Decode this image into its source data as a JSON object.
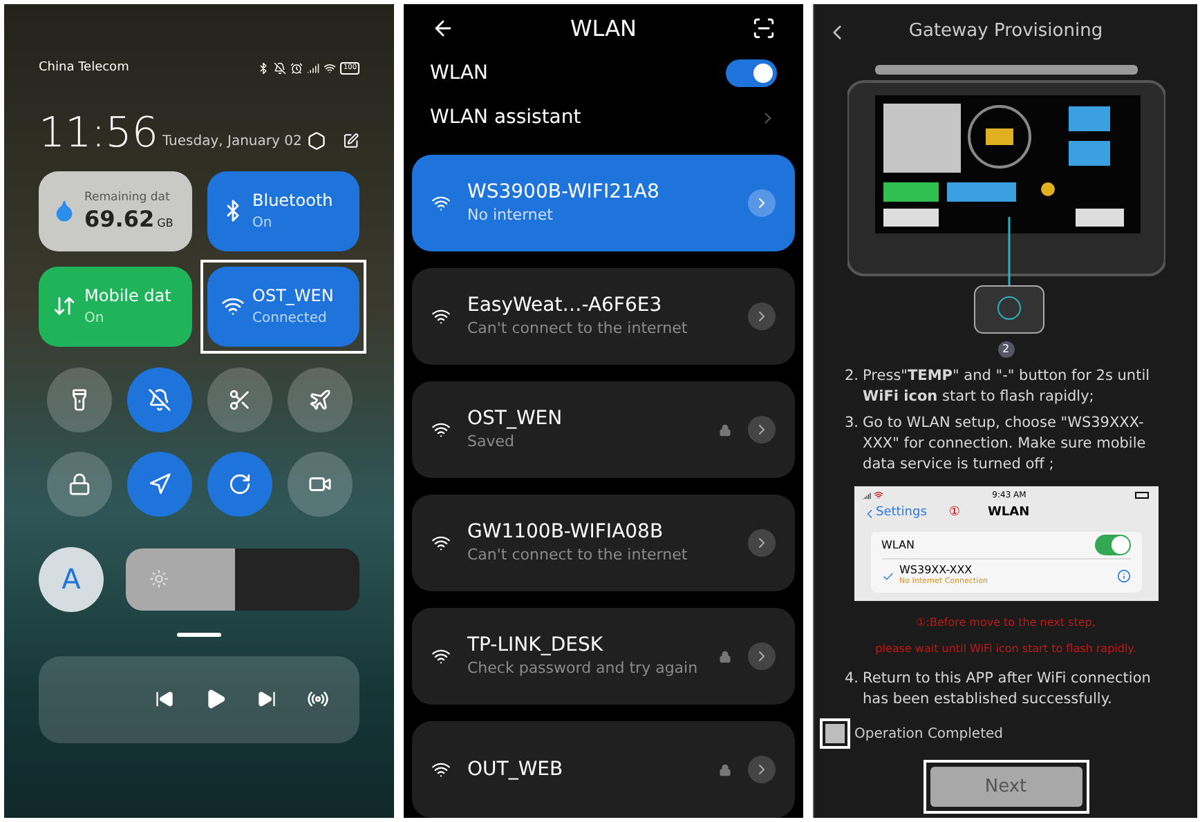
{
  "control_center": {
    "status_bar": {
      "carrier": "China Telecom",
      "battery": "100"
    },
    "time": "11:56",
    "date": "Tuesday, January 02",
    "tiles": [
      {
        "kind": "data",
        "title": "Remaining dat",
        "value": "69.62",
        "unit": "GB",
        "on": false,
        "highlighted": false
      },
      {
        "kind": "bluetooth",
        "title": "Bluetooth",
        "status": "On",
        "on": true,
        "highlighted": false
      },
      {
        "kind": "mobile",
        "title": "Mobile dat",
        "status": "On",
        "on": true,
        "highlighted": false
      },
      {
        "kind": "wifi",
        "title": "OST_WEN",
        "status": "Connected",
        "on": true,
        "highlighted": true
      }
    ],
    "toggles": [
      {
        "kind": "flashlight",
        "on": false
      },
      {
        "kind": "mute",
        "on": true
      },
      {
        "kind": "screenshot",
        "on": false
      },
      {
        "kind": "airplane",
        "on": false
      },
      {
        "kind": "lock",
        "on": false
      },
      {
        "kind": "location",
        "on": true
      },
      {
        "kind": "rotation",
        "on": true
      },
      {
        "kind": "video",
        "on": false
      }
    ],
    "auto_brightness": "A",
    "brightness": {
      "level": 0.47
    }
  },
  "wlan": {
    "title": "WLAN",
    "toggle_label": "WLAN",
    "enabled": true,
    "assistant": "WLAN assistant",
    "networks": [
      {
        "name": "WS3900B-WIFI21A8",
        "status": "No internet",
        "locked": false,
        "selected": true
      },
      {
        "name": "EasyWeat…-A6F6E3",
        "status": "Can't connect to the internet",
        "locked": false,
        "selected": false
      },
      {
        "name": "OST_WEN",
        "status": "Saved",
        "locked": true,
        "selected": false
      },
      {
        "name": "GW1100B-WIFIA08B",
        "status": "Can't connect to the internet",
        "locked": false,
        "selected": false
      },
      {
        "name": "TP-LINK_DESK",
        "status": "Check password and try again",
        "locked": true,
        "selected": false
      },
      {
        "name": "OUT_WEB",
        "locked": true,
        "selected": false
      }
    ]
  },
  "provisioning": {
    "title": "Gateway Provisioning",
    "callout": "2",
    "steps": [
      {
        "number": "2.",
        "text": "Press\"**TEMP**\" and \"-\" button for 2s until **WiFi icon** start to flash rapidly;"
      },
      {
        "number": "3.",
        "text": "Go to WLAN setup, choose \"WS39XXX-XXX\" for connection. Make sure mobile data service is turned off ;"
      }
    ],
    "screenshot": {
      "time": "9:43 AM",
      "back": "Settings",
      "marker": "①",
      "title": "WLAN",
      "toggle_label": "WLAN",
      "on": true,
      "network": "WS39XX-XXX",
      "network_status": "No Internet Connection"
    },
    "warnings": [
      "①:Before move to the next step,",
      "please wait until WiFi icon start to flash rapidly."
    ],
    "final_step": {
      "number": "4.",
      "text": "Return to this APP after WiFi connection has been established successfully."
    },
    "checkbox": {
      "label": "Operation Completed",
      "checked": false,
      "highlighted": true
    },
    "next_button": {
      "label": "Next",
      "disabled": true,
      "highlighted": true
    }
  }
}
